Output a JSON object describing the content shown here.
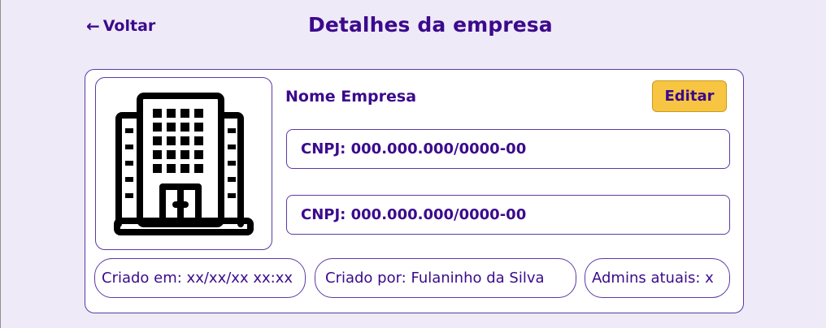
{
  "header": {
    "back_label": "Voltar",
    "title": "Detalhes da empresa"
  },
  "company": {
    "name": "Nome Empresa",
    "edit_label": "Editar",
    "fields": [
      "CNPJ: 000.000.000/0000-00",
      "CNPJ: 000.000.000/0000-00"
    ],
    "created_at": "Criado em: xx/xx/xx xx:xx",
    "created_by": "Criado por: Fulaninho da Silva",
    "admins": "Admins atuais: x",
    "logo_icon": "building-icon"
  },
  "colors": {
    "background": "#efeaf7",
    "primary": "#3b0a8c",
    "accent": "#f7c542",
    "card": "#ffffff"
  }
}
